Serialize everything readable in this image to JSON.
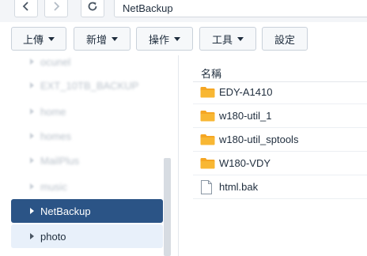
{
  "address_bar": {
    "back_icon": "chevron-left-icon",
    "forward_icon": "chevron-right-icon",
    "refresh_icon": "refresh-icon",
    "path": "NetBackup"
  },
  "toolbar": {
    "upload_label": "上傳",
    "create_label": "新增",
    "action_label": "操作",
    "tools_label": "工具",
    "settings_label": "設定"
  },
  "tree": {
    "items": [
      {
        "label": "ocunel",
        "blurred": true
      },
      {
        "label": "EXT_10TB_BACKUP",
        "blurred": true
      },
      {
        "label": "home",
        "blurred": true
      },
      {
        "label": "homes",
        "blurred": true
      },
      {
        "label": "MailPlus",
        "blurred": true
      },
      {
        "label": "music",
        "blurred": true
      },
      {
        "label": "NetBackup",
        "selected": true
      },
      {
        "label": "photo"
      }
    ]
  },
  "file_list": {
    "column_name": "名稱",
    "files": [
      {
        "name": "EDY-A1410",
        "type": "folder"
      },
      {
        "name": "w180-util_1",
        "type": "folder"
      },
      {
        "name": "w180-util_sptools",
        "type": "folder"
      },
      {
        "name": "W180-VDY",
        "type": "folder"
      },
      {
        "name": "html.bak",
        "type": "file"
      }
    ]
  },
  "colors": {
    "selected_bg": "#2b5486",
    "hover_bg": "#e8f0fa",
    "folder": "#f5a623"
  }
}
